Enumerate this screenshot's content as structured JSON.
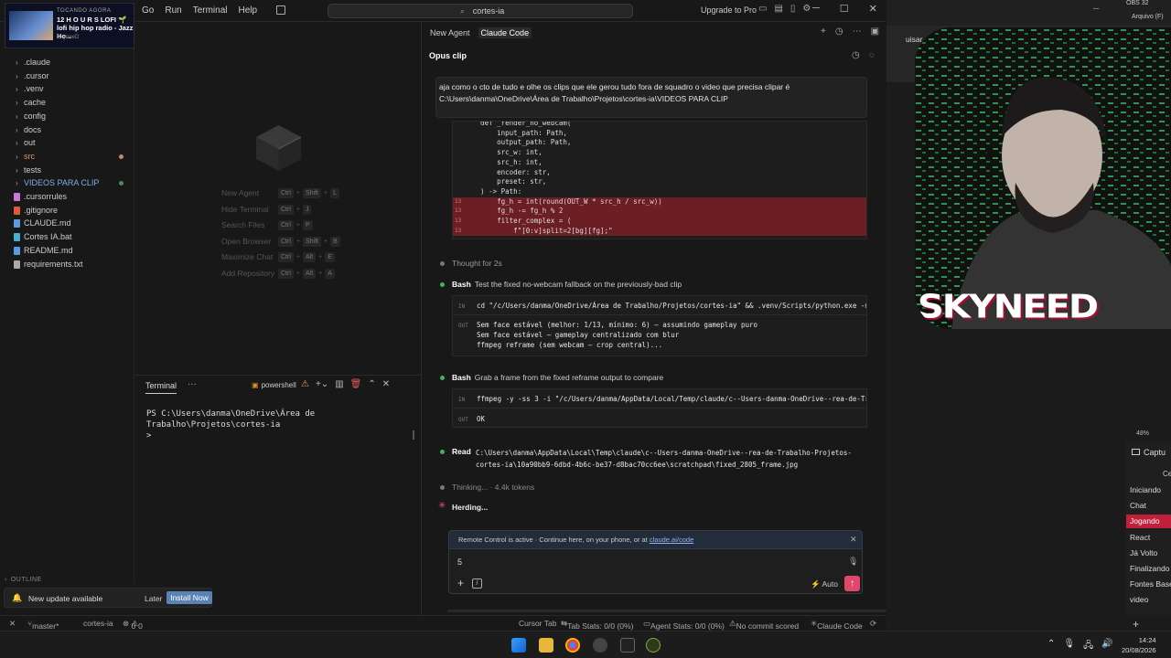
{
  "titlebar": {
    "menu": [
      "Go",
      "Run",
      "Terminal",
      "Help"
    ],
    "search": "cortes-ia",
    "upgrade": "Upgrade to Pro"
  },
  "media": {
    "tag": "TOCANDO AGORA",
    "song": "12 H O U R S LOFI 🌱 lofi hip hop radio - Jazz Ho...",
    "artist": "SkyneeD"
  },
  "explorer": {
    "items": [
      {
        "label": ".claude",
        "type": "folder"
      },
      {
        "label": ".cursor",
        "type": "folder"
      },
      {
        "label": ".venv",
        "type": "folder"
      },
      {
        "label": "cache",
        "type": "folder"
      },
      {
        "label": "config",
        "type": "folder"
      },
      {
        "label": "docs",
        "type": "folder"
      },
      {
        "label": "out",
        "type": "folder"
      },
      {
        "label": "src",
        "type": "folder",
        "status_color": "#c98a5a",
        "label_color": "#d99a6c"
      },
      {
        "label": "tests",
        "type": "folder"
      },
      {
        "label": "VIDEOS PARA CLIP",
        "type": "folder",
        "status_color": "#4a8a5a",
        "label_color": "#7fb0e8"
      },
      {
        "label": ".cursorrules",
        "type": "file",
        "icon_color": "#c678dd"
      },
      {
        "label": ".gitignore",
        "type": "file",
        "icon_color": "#e05a3a"
      },
      {
        "label": "CLAUDE.md",
        "type": "file",
        "icon_color": "#5a9ae0"
      },
      {
        "label": "Cortes IA.bat",
        "type": "file",
        "icon_color": "#4ab0d0"
      },
      {
        "label": "README.md",
        "type": "file",
        "icon_color": "#5a9ae0"
      },
      {
        "label": "requirements.txt",
        "type": "file",
        "icon_color": "#aaa"
      }
    ],
    "outline": "OUTLINE"
  },
  "launcher": {
    "shortcuts": [
      {
        "label": "New Agent",
        "keys": [
          "Ctrl",
          "Shift",
          "L"
        ]
      },
      {
        "label": "Hide Terminal",
        "keys": [
          "Ctrl",
          "J"
        ]
      },
      {
        "label": "Search Files",
        "keys": [
          "Ctrl",
          "P"
        ]
      },
      {
        "label": "Open Browser",
        "keys": [
          "Ctrl",
          "Shift",
          "B"
        ]
      },
      {
        "label": "Maximize Chat",
        "keys": [
          "Ctrl",
          "Alt",
          "E"
        ]
      },
      {
        "label": "Add Repository",
        "keys": [
          "Ctrl",
          "Alt",
          "A"
        ]
      }
    ]
  },
  "terminal": {
    "tab": "Terminal",
    "shell": "powershell",
    "prompt": "PS C:\\Users\\danma\\OneDrive\\Área de Trabalho\\Projetos\\cortes-ia",
    "cursor": ">"
  },
  "update": {
    "message": "New update available",
    "later": "Later",
    "install": "Install Now"
  },
  "statusbar": {
    "branch": "master*",
    "folder": "cortes-ia",
    "problems": "0",
    "warnings": "0",
    "cursor_tab": "Cursor Tab",
    "tab_stats": "Tab Stats: 0/0 (0%)",
    "agent_stats": "Agent Stats: 0/0 (0%)",
    "commit": "No commit scored",
    "claude": "Claude Code"
  },
  "chat": {
    "tabs": [
      "New Agent",
      "Claude Code"
    ],
    "title": "Opus clip",
    "user_message": "aja como o cto de tudo e olhe os clips que ele gerou tudo fora de squadro o video que precisa clipar é C:\\Users\\danma\\OneDrive\\Área de Trabalho\\Projetos\\cortes-ia\\VIDEOS PARA CLIP",
    "diff": [
      {
        "gut": "",
        "code": "    def _render_no_webcam(",
        "del": false
      },
      {
        "gut": "",
        "code": "        input_path: Path,",
        "del": false
      },
      {
        "gut": "",
        "code": "        output_path: Path,",
        "del": false
      },
      {
        "gut": "",
        "code": "        src_w: int,",
        "del": false
      },
      {
        "gut": "",
        "code": "        src_h: int,",
        "del": false
      },
      {
        "gut": "",
        "code": "        encoder: str,",
        "del": false
      },
      {
        "gut": "",
        "code": "        preset: str,",
        "del": false
      },
      {
        "gut": "",
        "code": "    ) -> Path:",
        "del": false
      },
      {
        "gut": "13",
        "code": "        fg_h = int(round(OUT_W * src_h / src_w))",
        "del": true
      },
      {
        "gut": "13",
        "code": "        fg_h -= fg_h % 2",
        "del": true
      },
      {
        "gut": "13",
        "code": "        filter_complex = (",
        "del": true
      },
      {
        "gut": "13",
        "code": "            f\"[0:v]split=2[bg][fg];\"",
        "del": true
      }
    ],
    "thought": "Thought for 2s",
    "bash1": {
      "name": "Bash",
      "desc": "Test the fixed no-webcam fallback on the previously-bad clip",
      "in_label": "IN",
      "in": "cd \"/c/Users/danma/OneDrive/Área de Trabalho/Projetos/cortes-ia\" && .venv/Scripts/python.exe -m py_compi",
      "out_label": "OUT",
      "out": "Sem face estável (melhor: 1/13, mínimo: 6) — assumindo gameplay puro\nSem face estável — gameplay centralizado com blur\nffmpeg reframe (sem webcam — crop central)..."
    },
    "bash2": {
      "name": "Bash",
      "desc": "Grab a frame from the fixed reframe output to compare",
      "in_label": "IN",
      "in": "ffmpeg -y -ss 3 -i \"/c/Users/danma/AppData/Local/Temp/claude/c--Users-danma-OneDrive--rea-de-Trabalho-Pr",
      "out_label": "OUT",
      "out": "OK"
    },
    "read": {
      "name": "Read",
      "path": "C:\\Users\\danma\\AppData\\Local\\Temp\\claude\\c--Users-danma-OneDrive--rea-de-Trabalho-Projetos-cortes-ia\\10a90bb9-6dbd-4b6c-be37-d8bac70cc6ee\\scratchpad\\fixed_2805_frame.jpg"
    },
    "thinking": "Thinking... · 4.4k tokens",
    "herding": "Herding...",
    "remote_text": "Remote Control is active · Continue here, on your phone, or at ",
    "remote_link": "claude.ai/code",
    "input_value": "5",
    "mode": "Auto"
  },
  "obs": {
    "top_right": "OBS 32",
    "menu_right": "Arquivo (F)",
    "browser_text": "uisar em VIDEO",
    "cam_name": "SKYNEED",
    "zoom": "48%",
    "captura": "Captu",
    "cen": "Cer",
    "scenes": [
      "Iniciando",
      "Chat",
      "Jogando",
      "React",
      "Já Volto",
      "Finalizando",
      "Fontes Base",
      "video"
    ],
    "active_scene": "Jogando"
  },
  "clock": {
    "time": "14:24",
    "date": "20/08/2026"
  },
  "colors": {
    "accent": "#e0476b",
    "active_scene": "#c0203a",
    "install": "#5b82b4"
  }
}
